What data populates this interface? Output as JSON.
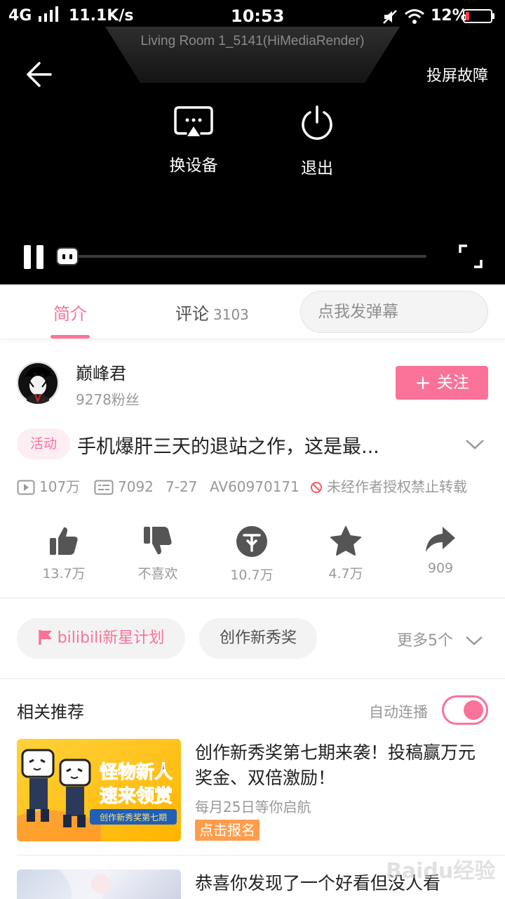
{
  "status_bar": {
    "network": "4G",
    "speed": "11.1K/s",
    "time": "10:53",
    "battery": "12%"
  },
  "player": {
    "device_name": "Living Room 1_5141(HiMediaRender)",
    "cast_fault": "投屏故障",
    "switch_device": "换设备",
    "exit": "退出",
    "progress": 0.0
  },
  "tabs": {
    "intro": "简介",
    "comments": "评论",
    "comment_count": "3103",
    "danmaku_placeholder": "点我发弹幕"
  },
  "uploader": {
    "name": "巅峰君",
    "fans": "9278粉丝",
    "follow": "关注",
    "follow_plus": "+"
  },
  "video": {
    "badge": "活动",
    "title": "手机爆肝三天的退站之作，这是最..."
  },
  "stats": {
    "views": "107万",
    "danmaku": "7092",
    "date": "7-27",
    "av": "AV60970171",
    "notice": "未经作者授权禁止转载"
  },
  "actions": {
    "like": "13.7万",
    "dislike": "不喜欢",
    "coin": "10.7万",
    "favorite": "4.7万",
    "share": "909"
  },
  "tags": {
    "items": [
      "bilibili新星计划",
      "创作新秀奖"
    ],
    "more": "更多5个"
  },
  "related": {
    "title": "相关推荐",
    "autoplay_label": "自动连播",
    "autoplay_on": true,
    "items": [
      {
        "title": "创作新秀奖第七期来袭！投稿赢万元奖金、双倍激励！",
        "subtitle": "每月25日等你启航",
        "badge": "点击报名",
        "thumb_text_1": "怪物新人",
        "thumb_text_2": "速来领赏",
        "thumb_text_3": "创作新秀奖第七期"
      },
      {
        "title": "恭喜你发现了一个好看但没人看"
      }
    ]
  },
  "watermark": "Baidu经验",
  "colors": {
    "accent": "#fb7299",
    "badge_orange": "#ff9d4d",
    "player_bg": "#000000"
  }
}
